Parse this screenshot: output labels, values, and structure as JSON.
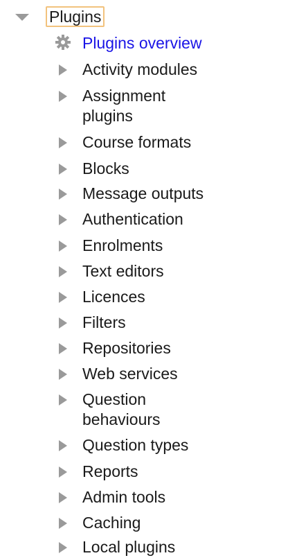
{
  "tree": {
    "root_label": "Plugins",
    "overview_label": "Plugins overview",
    "items": [
      "Activity modules",
      "Assignment plugins",
      "Course formats",
      "Blocks",
      "Message outputs",
      "Authentication",
      "Enrolments",
      "Text editors",
      "Licences",
      "Filters",
      "Repositories",
      "Web services",
      "Question behaviours",
      "Question types",
      "Reports",
      "Admin tools",
      "Caching",
      "Local plugins"
    ]
  },
  "colors": {
    "link": "#1a14e6",
    "text": "#1a1a1a",
    "caret": "#9a9a9a",
    "focus_border": "#f2c27d"
  },
  "icons": {
    "expanded": "caret-down-icon",
    "collapsed": "caret-right-icon",
    "overview": "gear-icon"
  }
}
